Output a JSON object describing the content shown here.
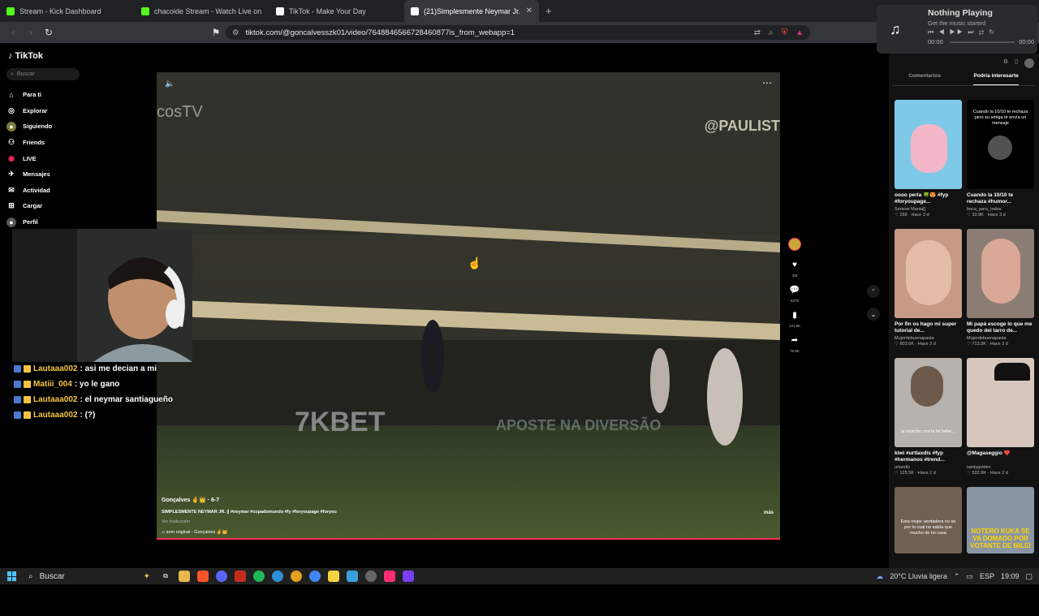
{
  "browser": {
    "tabs": [
      {
        "title": "Stream - Kick Dashboard",
        "color": "#53fc18"
      },
      {
        "title": "chacoide Stream - Watch Live on",
        "color": "#53fc18"
      },
      {
        "title": "TikTok - Make Your Day",
        "color": "#ffffff"
      },
      {
        "title": "(21)Simplesmente Neymar Jr. —",
        "color": "#ffffff"
      }
    ],
    "url": "tiktok.com/@goncalvesszk01/video/7648846566728460877is_from_webapp=1"
  },
  "media_popup": {
    "title": "Nothing Playing",
    "subtitle": "Get the music started",
    "time_start": "00:00",
    "time_end": "00:00"
  },
  "tiktok": {
    "logo": "TikTok",
    "search_placeholder": "Buscar",
    "nav": [
      {
        "label": "Para ti",
        "icon": "home-icon"
      },
      {
        "label": "Explorar",
        "icon": "compass-icon"
      },
      {
        "label": "Siguiendo",
        "icon": "following-icon"
      },
      {
        "label": "Friends",
        "icon": "friends-icon"
      },
      {
        "label": "LIVE",
        "icon": "live-icon"
      },
      {
        "label": "Mensajes",
        "icon": "message-icon"
      },
      {
        "label": "Actividad",
        "icon": "activity-icon"
      },
      {
        "label": "Cargar",
        "icon": "upload-icon"
      },
      {
        "label": "Perfil",
        "icon": "profile-icon"
      }
    ],
    "video": {
      "watermark_left": "cosTV",
      "watermark_right": "@PAULIST",
      "ad_board": "7KBET",
      "ad_board2": "APOSTE NA DIVERSÃO",
      "author": "Gonçalves 🤞👑 · 6-7",
      "caption": "SIMPLESMENTE NEYMAR JR. || #neymar #copadomundo #fy #foryoupage #foryou",
      "translate": "Ver traducción",
      "sound": "♫ som original - Gonçalves 🤞👑",
      "more": "más"
    },
    "actions": [
      {
        "icon": "heart-icon",
        "count": "2M"
      },
      {
        "icon": "comment-icon",
        "count": "5370"
      },
      {
        "icon": "bookmark-icon",
        "count": "131.9K"
      },
      {
        "icon": "share-icon",
        "count": "76.9K"
      }
    ],
    "right_panel": {
      "tabs": [
        "Comentarios",
        "Podría interesarte"
      ],
      "cards": [
        {
          "title": "oooo perla 🍀😍 #fyp #foryoupage...",
          "user": "Seriese Mania[]",
          "meta": "♡ 268 · Hace 3 d",
          "bg": "#7fc9e8",
          "overlay": ""
        },
        {
          "title": "Cuando la 10/10 te rechaza #humor...",
          "user": "boca_para_todos",
          "meta": "♡ 33.9K · Hace 3 d",
          "bg": "#000000",
          "overlay": "Cuando la 10/10 te rechaza pero su amiga te envía un mensaje"
        },
        {
          "title": "Por fin os hago mi super tutorial de...",
          "user": "Mujerdebuenapasta",
          "meta": "♡ 903.6K · Hace 3 d",
          "bg": "#c79a86",
          "overlay": ""
        },
        {
          "title": "Mi papá escoge lo que me quedo del tarro de...",
          "user": "Mujerdebuenapasta",
          "meta": "♡ 713.3K · Hace 3 d",
          "bg": "#8b7d74",
          "overlay": ""
        },
        {
          "title": "kiwi #urtlaxdis #fyp #hermanos #trend...",
          "user": "urlaxdis",
          "meta": "♡ 125.5K · Hace 2 d",
          "bg": "#b7b2ad",
          "overlay": "la relación con la lel bebe..."
        },
        {
          "title": "@Magaseggio ❤️",
          "user": "santygolden",
          "meta": "♡ 532.9K · Hace 2 d",
          "bg": "#d7c6bb",
          "overlay": ""
        },
        {
          "title": "",
          "user": "",
          "meta": "",
          "bg": "#6f6152",
          "overlay": "Esta mujer verdadera no sé por lo cual no sabía que mucho de mi casa"
        },
        {
          "title": "",
          "user": "",
          "meta": "",
          "bg": "#8a96a4",
          "overlay": "NOTERO KUKA SE VA DOMADO POR VOTANTE DE MILEI"
        }
      ]
    }
  },
  "chat": [
    {
      "user": "Lautaaa002",
      "msg": ": asi me decian a mi"
    },
    {
      "user": "Matiii_004",
      "msg": ": yo le gano"
    },
    {
      "user": "Lautaaa002",
      "msg": ": el neymar santiagueño"
    },
    {
      "user": "Lautaaa002",
      "msg": ": (?)"
    }
  ],
  "taskbar": {
    "search": "Buscar",
    "weather": "20°C Lluvia ligera",
    "lang": "ESP",
    "time": "19:09"
  }
}
